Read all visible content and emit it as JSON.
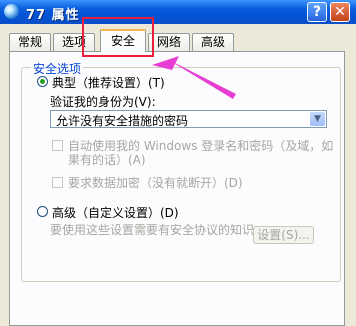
{
  "window": {
    "title": "77 属性",
    "help_label": "?",
    "close_label": "✕"
  },
  "tabs": [
    {
      "label": "常规"
    },
    {
      "label": "选项"
    },
    {
      "label": "安全"
    },
    {
      "label": "网络"
    },
    {
      "label": "高级"
    }
  ],
  "active_tab": "安全",
  "security": {
    "group_title": "安全选项",
    "typical_label": "典型（推荐设置）(T)",
    "typical_selected": true,
    "verify_label": "验证我的身份为(V):",
    "verify_value": "允许没有安全措施的密码",
    "auto_logon_line1": "自动使用我的 Windows 登录名和密码（及域，如",
    "auto_logon_line2": "果有的话）(A)",
    "encrypt_label": "要求数据加密（没有就断开）(D)",
    "advanced_label": "高级（自定义设置）(D)",
    "advanced_selected": false,
    "advanced_desc": "要使用这些设置需要有安全协议的知识。",
    "settings_label": "设置(S)..."
  },
  "annotation": {
    "color": "#e8203e",
    "arrow_color": "#e63dd2"
  }
}
